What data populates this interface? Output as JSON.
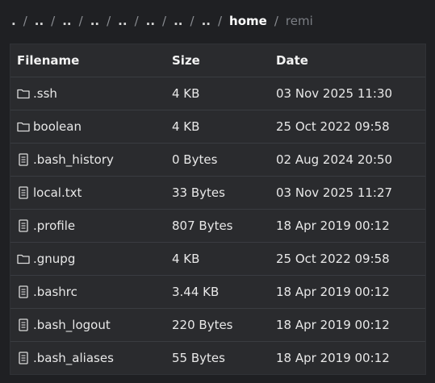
{
  "breadcrumb": {
    "items": [
      ".",
      "..",
      "..",
      "..",
      "..",
      "..",
      "..",
      "..",
      "home",
      "remi"
    ],
    "separator": "/"
  },
  "table": {
    "headers": {
      "name": "Filename",
      "size": "Size",
      "date": "Date"
    },
    "rows": [
      {
        "type": "folder",
        "icon": "folder-icon",
        "name": ".ssh",
        "size": "4 KB",
        "date": "03 Nov 2025 11:30"
      },
      {
        "type": "folder",
        "icon": "folder-icon",
        "name": "boolean",
        "size": "4 KB",
        "date": "25 Oct 2022 09:58"
      },
      {
        "type": "file",
        "icon": "file-icon",
        "name": ".bash_history",
        "size": "0 Bytes",
        "date": "02 Aug 2024 20:50"
      },
      {
        "type": "file",
        "icon": "file-icon",
        "name": "local.txt",
        "size": "33 Bytes",
        "date": "03 Nov 2025 11:27"
      },
      {
        "type": "file",
        "icon": "file-icon",
        "name": ".profile",
        "size": "807 Bytes",
        "date": "18 Apr 2019 00:12"
      },
      {
        "type": "folder",
        "icon": "folder-icon",
        "name": ".gnupg",
        "size": "4 KB",
        "date": "25 Oct 2022 09:58"
      },
      {
        "type": "file",
        "icon": "file-icon",
        "name": ".bashrc",
        "size": "3.44 KB",
        "date": "18 Apr 2019 00:12"
      },
      {
        "type": "file",
        "icon": "file-icon",
        "name": ".bash_logout",
        "size": "220 Bytes",
        "date": "18 Apr 2019 00:12"
      },
      {
        "type": "file",
        "icon": "file-icon",
        "name": ".bash_aliases",
        "size": "55 Bytes",
        "date": "18 Apr 2019 00:12"
      }
    ]
  },
  "colors": {
    "background": "#1f2023",
    "panel": "#2a2b2e",
    "row_divider": "#3a3c41",
    "text": "#e8e8e8",
    "muted": "#7c7f85"
  }
}
